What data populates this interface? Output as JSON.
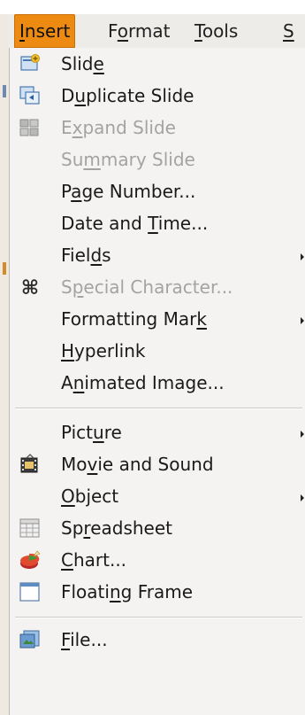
{
  "menubar": {
    "items": [
      {
        "pre": "",
        "u": "I",
        "post": "nsert"
      },
      {
        "pre": "F",
        "u": "o",
        "post": "rmat"
      },
      {
        "pre": "",
        "u": "T",
        "post": "ools"
      },
      {
        "pre": "",
        "u": "S",
        "post": ""
      }
    ]
  },
  "menu": {
    "items": [
      {
        "pre": "Slid",
        "u": "e",
        "post": "",
        "icon": "slide-icon",
        "disabled": false,
        "submenu": false
      },
      {
        "pre": "D",
        "u": "u",
        "post": "plicate Slide",
        "icon": "duplicate-slide-icon",
        "disabled": false,
        "submenu": false
      },
      {
        "pre": "E",
        "u": "x",
        "post": "pand Slide",
        "icon": "expand-slide-icon",
        "disabled": true,
        "submenu": false
      },
      {
        "pre": "Su",
        "u": "m",
        "post": "mary Slide",
        "icon": "",
        "disabled": true,
        "submenu": false
      },
      {
        "pre": "P",
        "u": "a",
        "post": "ge Number...",
        "icon": "",
        "disabled": false,
        "submenu": false
      },
      {
        "pre": "Date and ",
        "u": "T",
        "post": "ime...",
        "icon": "",
        "disabled": false,
        "submenu": false
      },
      {
        "pre": "Fiel",
        "u": "d",
        "post": "s",
        "icon": "",
        "disabled": false,
        "submenu": true
      },
      {
        "pre": "S",
        "u": "p",
        "post": "ecial Character...",
        "icon": "special-character-icon",
        "disabled": true,
        "submenu": false
      },
      {
        "pre": "Formatting Mar",
        "u": "k",
        "post": "",
        "icon": "",
        "disabled": false,
        "submenu": true
      },
      {
        "pre": "",
        "u": "H",
        "post": "yperlink",
        "icon": "",
        "disabled": false,
        "submenu": false
      },
      {
        "pre": "A",
        "u": "n",
        "post": "imated Image...",
        "icon": "",
        "disabled": false,
        "submenu": false
      },
      {
        "pre": "Pict",
        "u": "u",
        "post": "re",
        "icon": "",
        "disabled": false,
        "submenu": true
      },
      {
        "pre": "Mo",
        "u": "v",
        "post": "ie and Sound",
        "icon": "movie-icon",
        "disabled": false,
        "submenu": false
      },
      {
        "pre": "",
        "u": "O",
        "post": "bject",
        "icon": "",
        "disabled": false,
        "submenu": true
      },
      {
        "pre": "Sp",
        "u": "r",
        "post": "eadsheet",
        "icon": "spreadsheet-icon",
        "disabled": false,
        "submenu": false
      },
      {
        "pre": "",
        "u": "C",
        "post": "hart...",
        "icon": "chart-icon",
        "disabled": false,
        "submenu": false
      },
      {
        "pre": "Floati",
        "u": "n",
        "post": "g Frame",
        "icon": "floating-frame-icon",
        "disabled": false,
        "submenu": false
      },
      {
        "pre": "",
        "u": "F",
        "post": "ile...",
        "icon": "file-icon",
        "disabled": false,
        "submenu": false
      }
    ]
  },
  "colors": {
    "active_menu": "#ec8a12",
    "disabled_text": "#a3a3a3",
    "menu_bg": "#f4f3f1"
  }
}
